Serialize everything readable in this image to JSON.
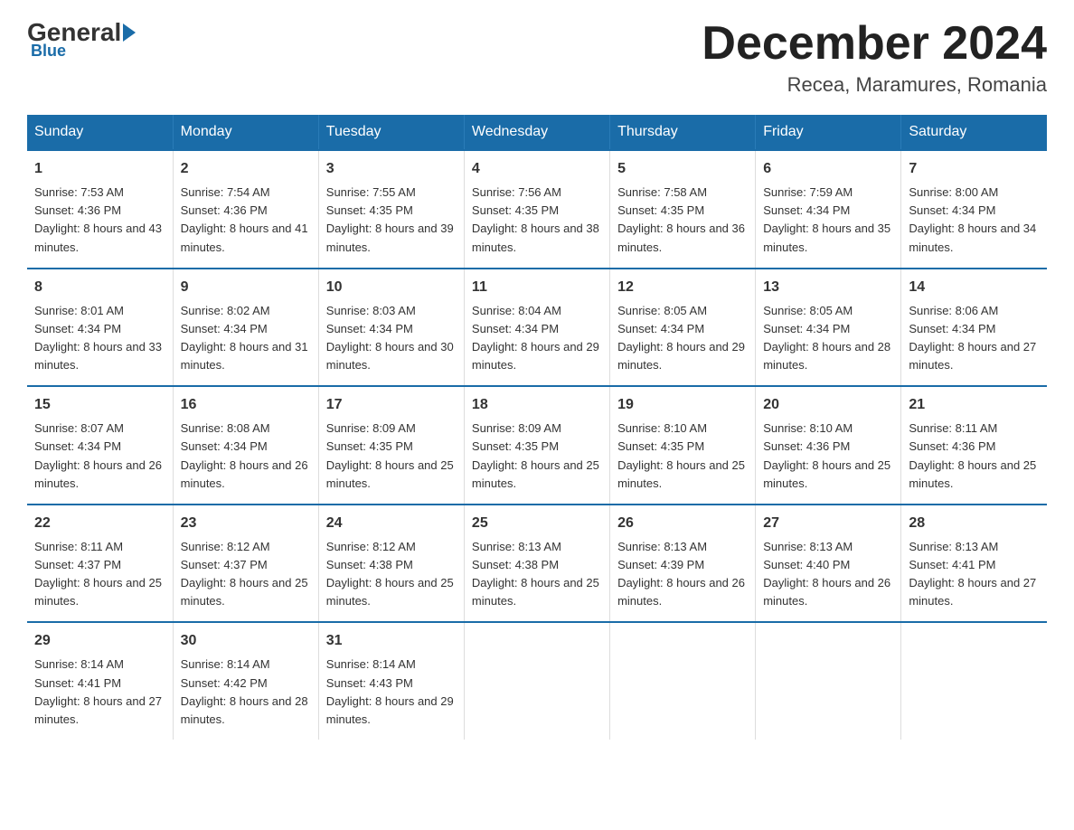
{
  "logo": {
    "general": "General",
    "blue": "Blue"
  },
  "title": "December 2024",
  "location": "Recea, Maramures, Romania",
  "days_of_week": [
    "Sunday",
    "Monday",
    "Tuesday",
    "Wednesday",
    "Thursday",
    "Friday",
    "Saturday"
  ],
  "weeks": [
    [
      {
        "day": "1",
        "sunrise": "7:53 AM",
        "sunset": "4:36 PM",
        "daylight": "8 hours and 43 minutes."
      },
      {
        "day": "2",
        "sunrise": "7:54 AM",
        "sunset": "4:36 PM",
        "daylight": "8 hours and 41 minutes."
      },
      {
        "day": "3",
        "sunrise": "7:55 AM",
        "sunset": "4:35 PM",
        "daylight": "8 hours and 39 minutes."
      },
      {
        "day": "4",
        "sunrise": "7:56 AM",
        "sunset": "4:35 PM",
        "daylight": "8 hours and 38 minutes."
      },
      {
        "day": "5",
        "sunrise": "7:58 AM",
        "sunset": "4:35 PM",
        "daylight": "8 hours and 36 minutes."
      },
      {
        "day": "6",
        "sunrise": "7:59 AM",
        "sunset": "4:34 PM",
        "daylight": "8 hours and 35 minutes."
      },
      {
        "day": "7",
        "sunrise": "8:00 AM",
        "sunset": "4:34 PM",
        "daylight": "8 hours and 34 minutes."
      }
    ],
    [
      {
        "day": "8",
        "sunrise": "8:01 AM",
        "sunset": "4:34 PM",
        "daylight": "8 hours and 33 minutes."
      },
      {
        "day": "9",
        "sunrise": "8:02 AM",
        "sunset": "4:34 PM",
        "daylight": "8 hours and 31 minutes."
      },
      {
        "day": "10",
        "sunrise": "8:03 AM",
        "sunset": "4:34 PM",
        "daylight": "8 hours and 30 minutes."
      },
      {
        "day": "11",
        "sunrise": "8:04 AM",
        "sunset": "4:34 PM",
        "daylight": "8 hours and 29 minutes."
      },
      {
        "day": "12",
        "sunrise": "8:05 AM",
        "sunset": "4:34 PM",
        "daylight": "8 hours and 29 minutes."
      },
      {
        "day": "13",
        "sunrise": "8:05 AM",
        "sunset": "4:34 PM",
        "daylight": "8 hours and 28 minutes."
      },
      {
        "day": "14",
        "sunrise": "8:06 AM",
        "sunset": "4:34 PM",
        "daylight": "8 hours and 27 minutes."
      }
    ],
    [
      {
        "day": "15",
        "sunrise": "8:07 AM",
        "sunset": "4:34 PM",
        "daylight": "8 hours and 26 minutes."
      },
      {
        "day": "16",
        "sunrise": "8:08 AM",
        "sunset": "4:34 PM",
        "daylight": "8 hours and 26 minutes."
      },
      {
        "day": "17",
        "sunrise": "8:09 AM",
        "sunset": "4:35 PM",
        "daylight": "8 hours and 25 minutes."
      },
      {
        "day": "18",
        "sunrise": "8:09 AM",
        "sunset": "4:35 PM",
        "daylight": "8 hours and 25 minutes."
      },
      {
        "day": "19",
        "sunrise": "8:10 AM",
        "sunset": "4:35 PM",
        "daylight": "8 hours and 25 minutes."
      },
      {
        "day": "20",
        "sunrise": "8:10 AM",
        "sunset": "4:36 PM",
        "daylight": "8 hours and 25 minutes."
      },
      {
        "day": "21",
        "sunrise": "8:11 AM",
        "sunset": "4:36 PM",
        "daylight": "8 hours and 25 minutes."
      }
    ],
    [
      {
        "day": "22",
        "sunrise": "8:11 AM",
        "sunset": "4:37 PM",
        "daylight": "8 hours and 25 minutes."
      },
      {
        "day": "23",
        "sunrise": "8:12 AM",
        "sunset": "4:37 PM",
        "daylight": "8 hours and 25 minutes."
      },
      {
        "day": "24",
        "sunrise": "8:12 AM",
        "sunset": "4:38 PM",
        "daylight": "8 hours and 25 minutes."
      },
      {
        "day": "25",
        "sunrise": "8:13 AM",
        "sunset": "4:38 PM",
        "daylight": "8 hours and 25 minutes."
      },
      {
        "day": "26",
        "sunrise": "8:13 AM",
        "sunset": "4:39 PM",
        "daylight": "8 hours and 26 minutes."
      },
      {
        "day": "27",
        "sunrise": "8:13 AM",
        "sunset": "4:40 PM",
        "daylight": "8 hours and 26 minutes."
      },
      {
        "day": "28",
        "sunrise": "8:13 AM",
        "sunset": "4:41 PM",
        "daylight": "8 hours and 27 minutes."
      }
    ],
    [
      {
        "day": "29",
        "sunrise": "8:14 AM",
        "sunset": "4:41 PM",
        "daylight": "8 hours and 27 minutes."
      },
      {
        "day": "30",
        "sunrise": "8:14 AM",
        "sunset": "4:42 PM",
        "daylight": "8 hours and 28 minutes."
      },
      {
        "day": "31",
        "sunrise": "8:14 AM",
        "sunset": "4:43 PM",
        "daylight": "8 hours and 29 minutes."
      },
      null,
      null,
      null,
      null
    ]
  ]
}
